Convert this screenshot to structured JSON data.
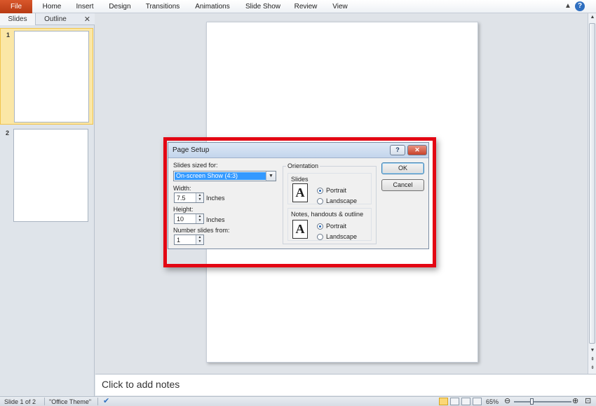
{
  "ribbon": {
    "file_label": "File",
    "tabs": [
      "Home",
      "Insert",
      "Design",
      "Transitions",
      "Animations",
      "Slide Show",
      "Review",
      "View"
    ],
    "collapse_glyph": "▲",
    "help_glyph": "?"
  },
  "slides_panel": {
    "tabs": [
      "Slides",
      "Outline"
    ],
    "close_glyph": "✕",
    "thumbnails": [
      {
        "number": "1"
      },
      {
        "number": "2"
      }
    ]
  },
  "notes": {
    "placeholder": "Click to add notes"
  },
  "status_bar": {
    "slide_position": "Slide 1 of 2",
    "theme": "\"Office Theme\"",
    "zoom_level": "65%",
    "zoom_out": "⊖",
    "zoom_in": "⊕",
    "fit_glyph": "⊡"
  },
  "dialog": {
    "title": "Page Setup",
    "help_glyph": "?",
    "close_glyph": "✕",
    "slides_sized_for_label": "Slides sized for:",
    "slides_sized_for_value": "On-screen Show (4:3)",
    "width_label": "Width:",
    "width_value": "7.5",
    "width_unit": "Inches",
    "height_label": "Height:",
    "height_value": "10",
    "height_unit": "Inches",
    "number_from_label": "Number slides from:",
    "number_from_value": "1",
    "orientation_label": "Orientation",
    "slides_group_label": "Slides",
    "notes_group_label": "Notes, handouts & outline",
    "portrait_label": "Portrait",
    "landscape_label": "Landscape",
    "doc_glyph": "A",
    "ok_label": "OK",
    "cancel_label": "Cancel",
    "slides_orientation_selected": "Portrait",
    "notes_orientation_selected": "Portrait"
  },
  "highlight_color": "#e30613"
}
